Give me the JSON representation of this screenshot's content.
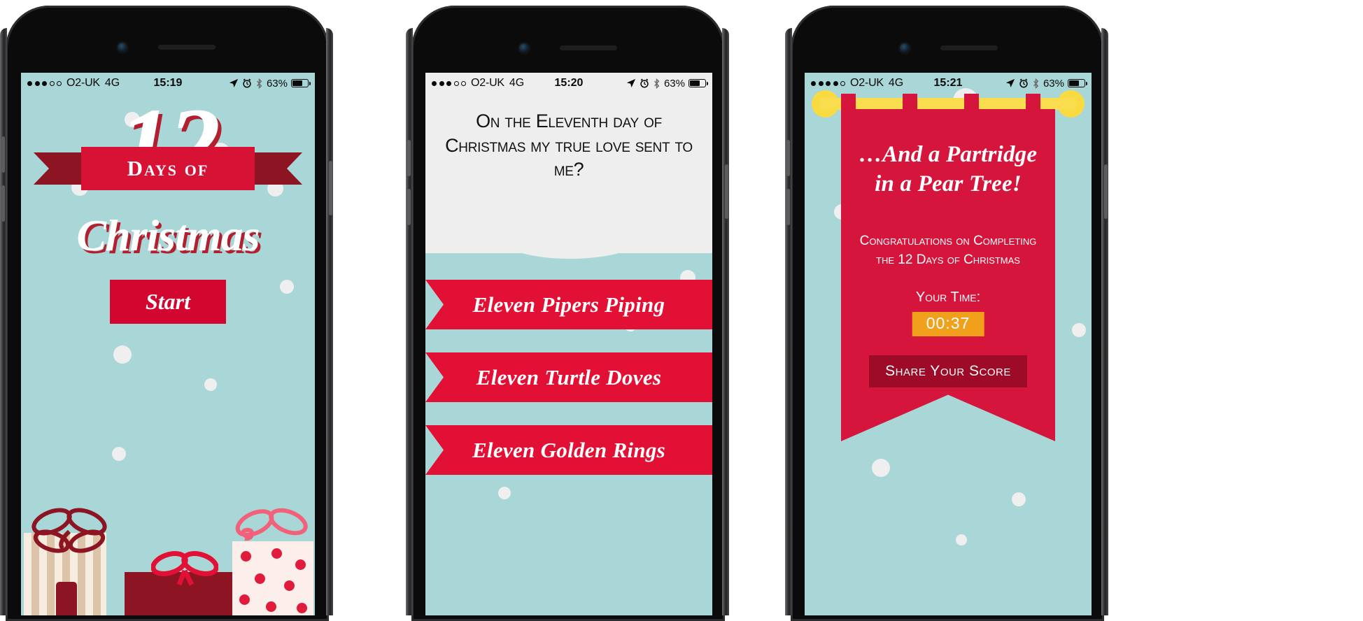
{
  "meta": {
    "theme_teal": "#a9d6d6",
    "theme_red": "#d6153c",
    "theme_dark_red": "#8c1423",
    "theme_yellow": "#f9dd4e",
    "theme_orange": "#f0a01a",
    "theme_offwhite": "#eeeeef"
  },
  "phones": [
    {
      "id": "splash",
      "status_bar": {
        "signal_filled": 3,
        "signal_total": 5,
        "carrier": "O2-UK",
        "network": "4G",
        "time": "15:19",
        "battery_percent": "63%",
        "battery_level": 0.63,
        "icons": [
          "location-arrow-icon",
          "alarm-clock-icon",
          "bluetooth-icon",
          "battery-icon"
        ]
      },
      "logo": {
        "number": "12",
        "ribbon_text": "Days of",
        "script_text": "Christmas"
      },
      "start_button": "Start",
      "decor": {
        "gift_boxes": [
          "striped-gift-box",
          "red-gift-box",
          "polkadot-gift-box"
        ],
        "snow_count": 9
      }
    },
    {
      "id": "question",
      "status_bar": {
        "signal_filled": 3,
        "signal_total": 5,
        "carrier": "O2-UK",
        "network": "4G",
        "time": "15:20",
        "battery_percent": "63%",
        "battery_level": 0.63,
        "icons": [
          "location-arrow-icon",
          "alarm-clock-icon",
          "bluetooth-icon",
          "battery-icon"
        ]
      },
      "question": "On the Eleventh day of Christmas my true love sent to me?",
      "answers": [
        "Eleven Pipers Piping",
        "Eleven Turtle Doves",
        "Eleven Golden Rings"
      ]
    },
    {
      "id": "result",
      "status_bar": {
        "signal_filled": 4,
        "signal_total": 5,
        "carrier": "O2-UK",
        "network": "4G",
        "time": "15:21",
        "battery_percent": "63%",
        "battery_level": 0.63,
        "icons": [
          "location-arrow-icon",
          "alarm-clock-icon",
          "bluetooth-icon",
          "battery-icon"
        ]
      },
      "banner": {
        "title": "…And a Partridge in a Pear Tree!",
        "subtitle": "Congratulations on Completing the 12 Days of Christmas",
        "time_label": "Your Time:",
        "time_value": "00:37",
        "share_button": "Share Your Score"
      }
    }
  ]
}
